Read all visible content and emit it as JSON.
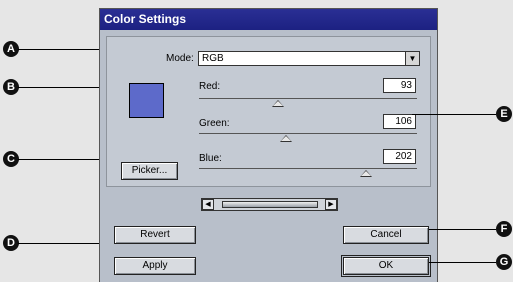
{
  "dialog": {
    "title": "Color Settings"
  },
  "mode": {
    "label": "Mode:",
    "value": "RGB"
  },
  "swatch_color": "#5d6aca",
  "channels": [
    {
      "label": "Red:",
      "value": "93"
    },
    {
      "label": "Green:",
      "value": "106"
    },
    {
      "label": "Blue:",
      "value": "202"
    }
  ],
  "buttons": {
    "picker": "Picker...",
    "revert": "Revert",
    "apply": "Apply",
    "cancel": "Cancel",
    "ok": "OK"
  },
  "callouts": {
    "a": "A",
    "b": "B",
    "c": "C",
    "d": "D",
    "e": "E",
    "f": "F",
    "g": "G"
  }
}
